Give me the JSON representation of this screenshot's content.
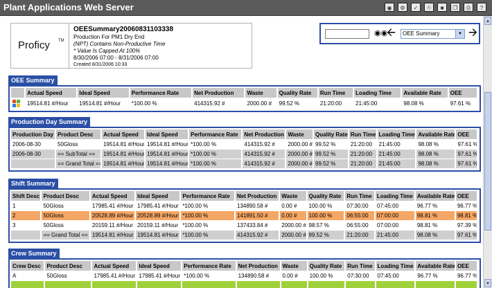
{
  "app": {
    "title": "Plant Applications Web Server",
    "toolbar_icons": [
      "binoculars-icon",
      "network-icon",
      "check-icon",
      "globe-icon",
      "folders-icon",
      "copy-icon",
      "print-icon",
      "help-icon"
    ]
  },
  "header": {
    "logo": "Proficy",
    "logo_tm": "TM",
    "report_title": "OEESummary20060831103338",
    "subtitle": "Production For PM1 Dry End",
    "npt_note": "(NPT) Contains Non-Productive Time",
    "cap_note": "* Value Is Capped At 100%",
    "range": "8/30/2006 07:00 - 8/31/2006 07:00",
    "created": "Created 8/31/2006 10:33"
  },
  "nav": {
    "search_value": "",
    "report_selected": "OEE Summary"
  },
  "sections": {
    "oee": {
      "title": "OEE Summary",
      "columns": [
        "",
        "Actual Speed",
        "Ideal Speed",
        "Performance Rate",
        "Net Production",
        "Waste",
        "Quality Rate",
        "Run Time",
        "Loading Time",
        "Available Rate",
        "OEE"
      ],
      "rows": [
        {
          "style": "white",
          "cells": [
            "",
            "19514.81 #/Hour",
            "19514.81 #/Hour",
            "*100.00 %",
            "414315.92 #",
            "2000.00 #",
            "99.52 %",
            "21:20:00",
            "21:45:00",
            "98.08 %",
            "97.61 %"
          ]
        }
      ]
    },
    "production_day": {
      "title": "Production Day Summary",
      "columns": [
        "Production Day",
        "Product Desc",
        "Actual Speed",
        "Ideal Speed",
        "Performance Rate",
        "Net Production",
        "Waste",
        "Quality Rate",
        "Run Time",
        "Loading Time",
        "Available Rate",
        "OEE"
      ],
      "rows": [
        {
          "style": "white",
          "cells": [
            "2006-08-30",
            "50Gloss",
            "19514.81 #/Hour",
            "19514.81 #/Hour",
            "*100.00 %",
            "414315.92 #",
            "2000.00 #",
            "99.52 %",
            "21:20:00",
            "21:45:00",
            "98.08 %",
            "97.61 %"
          ]
        },
        {
          "style": "grey",
          "cells": [
            "2006-08-30",
            "== SubTotal ==",
            "19514.81 #/Hour",
            "19514.81 #/Hour",
            "*100.00 %",
            "414315.92 #",
            "2000.00 #",
            "99.52 %",
            "21:20:00",
            "21:45:00",
            "98.08 %",
            "97.61 %"
          ]
        },
        {
          "style": "grey",
          "cells": [
            "",
            "== Grand Total ==",
            "19514.81 #/Hour",
            "19514.81 #/Hour",
            "*100.00 %",
            "414315.92 #",
            "2000.00 #",
            "99.52 %",
            "21:20:00",
            "21:45:00",
            "98.08 %",
            "97.61 %"
          ]
        }
      ]
    },
    "shift": {
      "title": "Shift Summary",
      "columns": [
        "Shift Desc",
        "Product Desc",
        "Actual Speed",
        "Ideal Speed",
        "Performance Rate",
        "Net Production",
        "Waste",
        "Quality Rate",
        "Run Time",
        "Loading Time",
        "Available Rate",
        "OEE"
      ],
      "rows": [
        {
          "style": "white",
          "cells": [
            "1",
            "50Gloss",
            "17985.41 #/Hour",
            "17985.41 #/Hour",
            "*100.00 %",
            "134890.58 #",
            "0.00 #",
            "100.00 %",
            "07:30:00",
            "07:45:00",
            "96.77 %",
            "96.77 %"
          ]
        },
        {
          "style": "orange",
          "cells": [
            "2",
            "50Gloss",
            "20528.89 #/Hour",
            "20528.89 #/Hour",
            "*100.00 %",
            "141891.50 #",
            "0.00 #",
            "100.00 %",
            "06:55:00",
            "07:00:00",
            "98.81 %",
            "98.81 %"
          ]
        },
        {
          "style": "white",
          "cells": [
            "3",
            "50Gloss",
            "20159.11 #/Hour",
            "20159.11 #/Hour",
            "*100.00 %",
            "137433.84 #",
            "2000.00 #",
            "98.57 %",
            "06:55:00",
            "07:00:00",
            "98.81 %",
            "97.39 %"
          ]
        },
        {
          "style": "grey",
          "cells": [
            "",
            "== Grand Total ==",
            "19514.81 #/Hour",
            "19514.81 #/Hour",
            "*100.00 %",
            "414315.92 #",
            "2000.00 #",
            "99.52 %",
            "21:20:00",
            "21:45:00",
            "98.08 %",
            "97.61 %"
          ]
        }
      ]
    },
    "crew": {
      "title": "Crew Summary",
      "columns": [
        "Crew Desc",
        "Product Desc",
        "Actual Speed",
        "Ideal Speed",
        "Performance Rate",
        "Net Production",
        "Waste",
        "Quality Rate",
        "Run Time",
        "Loading Time",
        "Available Rate",
        "OEE"
      ],
      "rows": [
        {
          "style": "white",
          "cells": [
            "A",
            "50Gloss",
            "17985.41 #/Hour",
            "17985.41 #/Hour",
            "*100.00 %",
            "134890.58 #",
            "0.00 #",
            "100.00 %",
            "07:30:00",
            "07:45:00",
            "96.77 %",
            "96.77 %"
          ]
        },
        {
          "style": "green",
          "cells": [
            "",
            "",
            "",
            "",
            "",
            "",
            "",
            "",
            "",
            "",
            "",
            ""
          ]
        }
      ]
    }
  },
  "colors": {
    "titlebar": "#5a5a5a",
    "accent_blue": "#2a4fa5",
    "header_grey": "#c8c8c8",
    "subtotal_grey": "#cfcfcf",
    "highlight_orange": "#f5a765",
    "highlight_green": "#9fd23a"
  }
}
